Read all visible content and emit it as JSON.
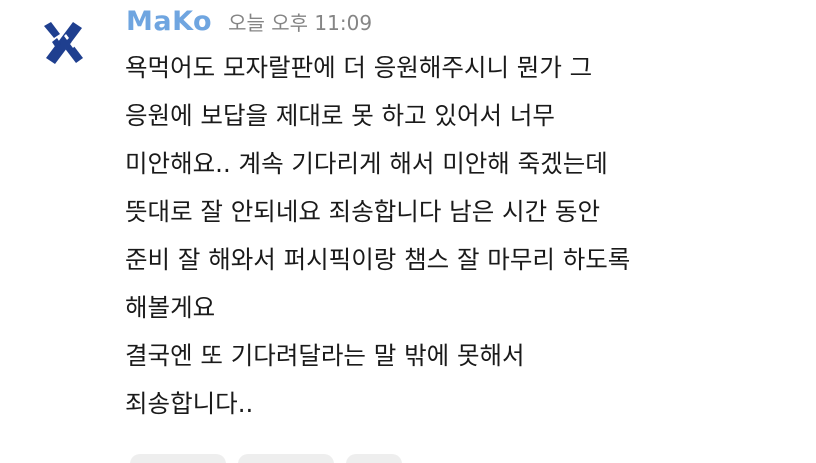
{
  "message": {
    "author": "MaKo",
    "timestamp": "오늘 오후 11:09",
    "lines": [
      "욕먹어도 모자랄판에 더 응원해주시니 뭔가 그",
      "응원에 보답을 제대로 못 하고 있어서 너무",
      "미안해요.. 계속 기다리게 해서 미안해 죽겠는데",
      "뜻대로 잘 안되네요 죄송합니다 남은 시간 동안",
      "준비 잘 해와서 퍼시픽이랑 챔스 잘 마무리 하도록",
      "해볼게요",
      "결국엔 또 기다려달라는 말 밖에 못해서",
      "죄송합니다.."
    ],
    "avatar_icon": "x-logo-icon"
  },
  "colors": {
    "author": "#6fa5e0",
    "timestamp": "#858585",
    "text": "#1a1a1a",
    "avatar": "#1f3f8f",
    "reaction_chip": "#eeeeee"
  }
}
